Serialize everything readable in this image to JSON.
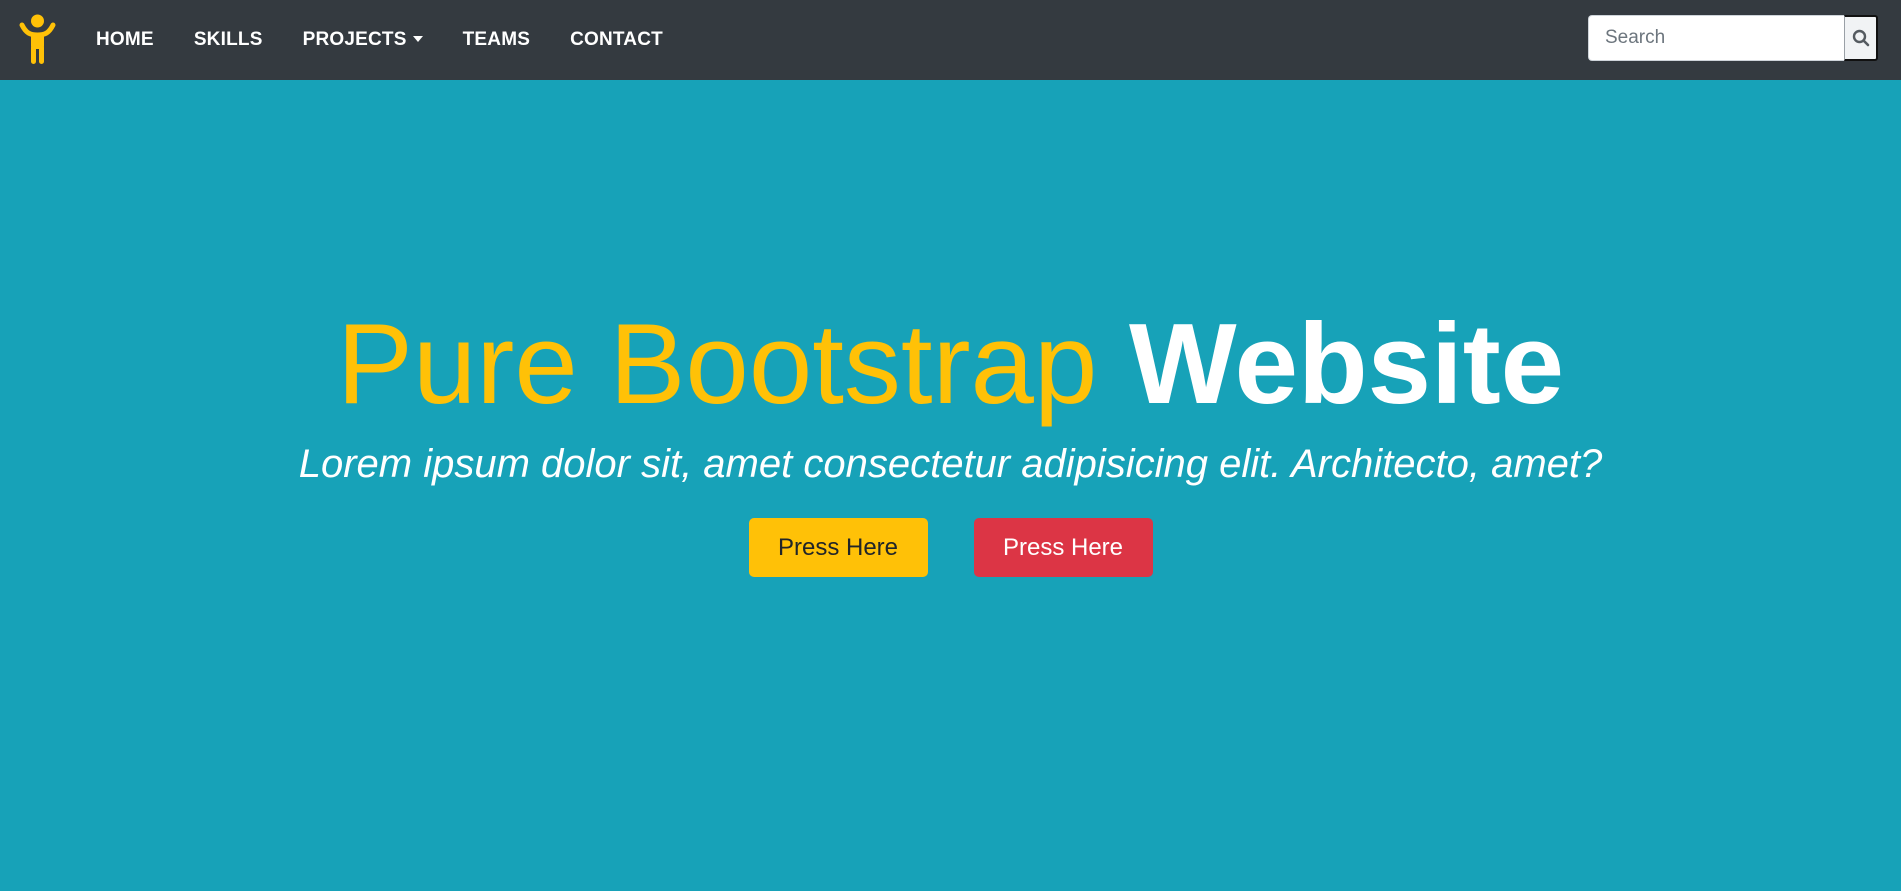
{
  "navbar": {
    "brand_icon": "person-arms-raised-icon",
    "links": [
      {
        "label": "HOME"
      },
      {
        "label": "SKILLS"
      },
      {
        "label": "PROJECTS",
        "dropdown": true
      },
      {
        "label": "TEAMS"
      },
      {
        "label": "CONTACT"
      }
    ],
    "search": {
      "placeholder": "Search",
      "value": "",
      "button_icon": "search-icon"
    }
  },
  "hero": {
    "title_light": "Pure Bootstrap",
    "title_bold": "Website",
    "subtitle": "Lorem ipsum dolor sit, amet consectetur adipisicing elit. Architecto, amet?",
    "buttons": [
      {
        "label": "Press Here",
        "style": "warning"
      },
      {
        "label": "Press Here",
        "style": "danger"
      }
    ]
  },
  "colors": {
    "background": "#17a2b8",
    "navbar": "#343a40",
    "accent_yellow": "#ffc107",
    "accent_red": "#dc3545",
    "text_white": "#ffffff"
  }
}
